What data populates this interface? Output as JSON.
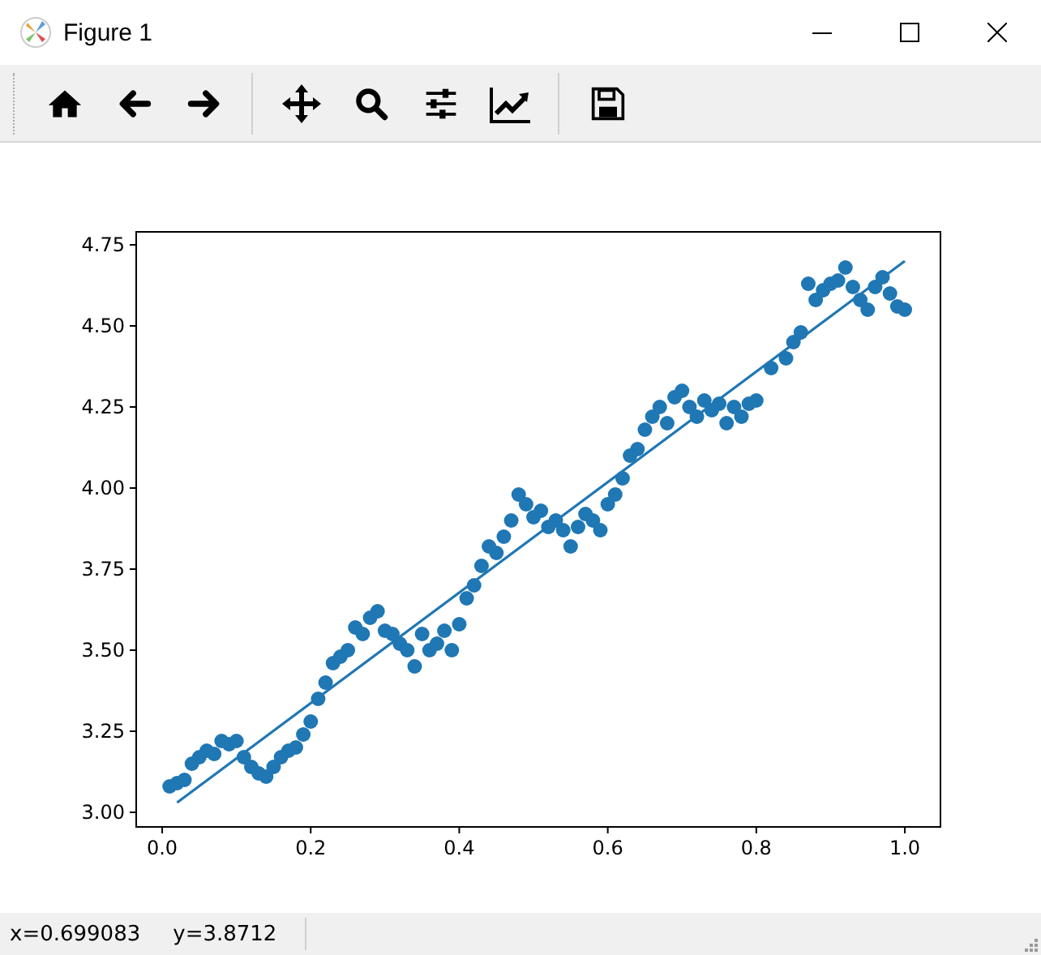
{
  "window": {
    "title": "Figure 1"
  },
  "figure": {
    "chart_data": {
      "type": "scatter",
      "xlim": [
        -0.035,
        1.048
      ],
      "ylim": [
        2.955,
        4.79
      ],
      "xticks": [
        {
          "value": 0,
          "label": "0.0"
        },
        {
          "value": 0.2,
          "label": "0.2"
        },
        {
          "value": 0.4,
          "label": "0.4"
        },
        {
          "value": 0.6,
          "label": "0.6"
        },
        {
          "value": 0.8,
          "label": "0.8"
        },
        {
          "value": 1,
          "label": "1.0"
        }
      ],
      "yticks": [
        {
          "value": 3,
          "label": "3.00"
        },
        {
          "value": 3.25,
          "label": "3.25"
        },
        {
          "value": 3.5,
          "label": "3.50"
        },
        {
          "value": 3.75,
          "label": "3.75"
        },
        {
          "value": 4,
          "label": "4.00"
        },
        {
          "value": 4.25,
          "label": "4.25"
        },
        {
          "value": 4.5,
          "label": "4.50"
        },
        {
          "value": 4.75,
          "label": "4.75"
        }
      ],
      "series": [
        {
          "color": "#1f77b4",
          "x": [
            0.01,
            0.02,
            0.03,
            0.04,
            0.05,
            0.06,
            0.07,
            0.08,
            0.09,
            0.1,
            0.11,
            0.12,
            0.13,
            0.14,
            0.15,
            0.16,
            0.17,
            0.18,
            0.19,
            0.2,
            0.21,
            0.22,
            0.23,
            0.24,
            0.25,
            0.26,
            0.27,
            0.28,
            0.29,
            0.3,
            0.31,
            0.32,
            0.33,
            0.34,
            0.35,
            0.36,
            0.37,
            0.38,
            0.39,
            0.4,
            0.41,
            0.42,
            0.43,
            0.44,
            0.45,
            0.46,
            0.47,
            0.48,
            0.49,
            0.5,
            0.51,
            0.52,
            0.53,
            0.54,
            0.55,
            0.56,
            0.57,
            0.58,
            0.59,
            0.6,
            0.61,
            0.62,
            0.63,
            0.64,
            0.65,
            0.66,
            0.67,
            0.68,
            0.69,
            0.7,
            0.71,
            0.72,
            0.73,
            0.74,
            0.75,
            0.76,
            0.77,
            0.78,
            0.79,
            0.8,
            0.82,
            0.84,
            0.85,
            0.86,
            0.87,
            0.88,
            0.89,
            0.9,
            0.91,
            0.92,
            0.93,
            0.94,
            0.95,
            0.96,
            0.97,
            0.98,
            0.99,
            1.0
          ],
          "values": [
            3.08,
            3.09,
            3.1,
            3.15,
            3.17,
            3.19,
            3.18,
            3.22,
            3.21,
            3.22,
            3.17,
            3.14,
            3.12,
            3.11,
            3.14,
            3.17,
            3.19,
            3.2,
            3.24,
            3.28,
            3.35,
            3.4,
            3.46,
            3.48,
            3.5,
            3.57,
            3.55,
            3.6,
            3.62,
            3.56,
            3.55,
            3.52,
            3.5,
            3.45,
            3.55,
            3.5,
            3.52,
            3.56,
            3.5,
            3.58,
            3.66,
            3.7,
            3.76,
            3.82,
            3.8,
            3.85,
            3.9,
            3.98,
            3.95,
            3.91,
            3.93,
            3.88,
            3.9,
            3.87,
            3.82,
            3.88,
            3.92,
            3.9,
            3.87,
            3.95,
            3.98,
            4.03,
            4.1,
            4.12,
            4.18,
            4.22,
            4.25,
            4.2,
            4.28,
            4.3,
            4.25,
            4.22,
            4.27,
            4.24,
            4.26,
            4.2,
            4.25,
            4.22,
            4.26,
            4.27,
            4.37,
            4.4,
            4.45,
            4.48,
            4.63,
            4.58,
            4.61,
            4.63,
            4.64,
            4.68,
            4.62,
            4.58,
            4.55,
            4.62,
            4.65,
            4.6,
            4.56,
            4.55
          ]
        },
        {
          "type": "line",
          "color": "#1f77b4",
          "x": [
            0.02,
            1.0
          ],
          "values": [
            3.03,
            4.7
          ]
        }
      ]
    }
  },
  "status_bar": {
    "x_reading": "x=0.699083",
    "y_reading": "y=3.8712"
  }
}
